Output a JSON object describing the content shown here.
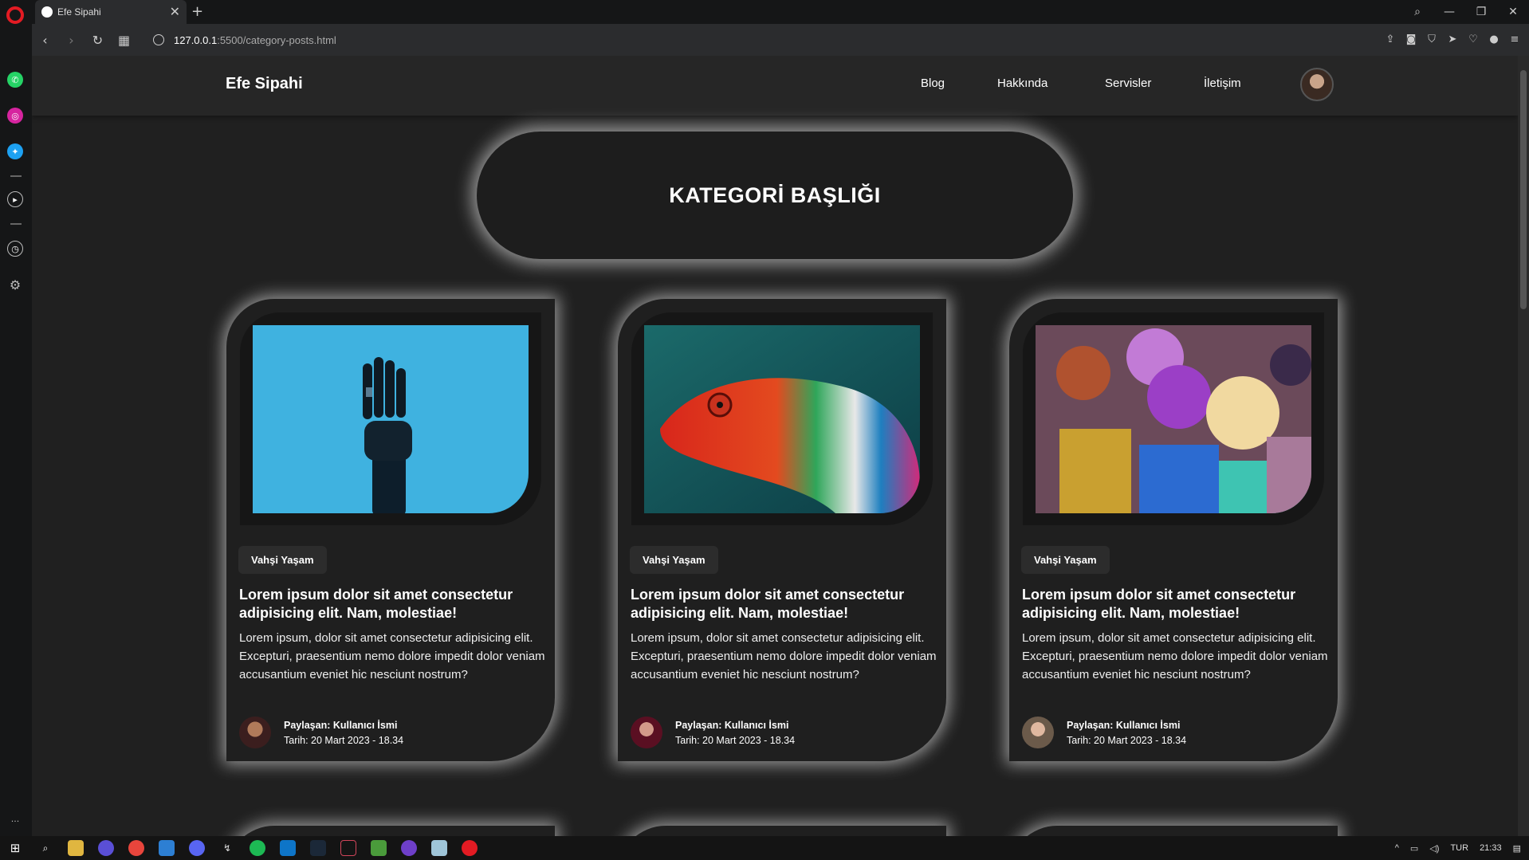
{
  "browser": {
    "tab_title": "Efe Sipahi",
    "tab_close": "✕",
    "new_tab": "+",
    "url_host": "127.0.0.1",
    "url_path": ":5500/category-posts.html"
  },
  "site": {
    "brand": "Efe Sipahi",
    "nav": [
      "Blog",
      "Hakkında",
      "Servisler",
      "İletişim"
    ]
  },
  "hero": {
    "title": "KATEGORİ BAŞLIĞI"
  },
  "cards": [
    {
      "category": "Vahşi Yaşam",
      "title": "Lorem ipsum dolor sit amet consectetur adipisicing elit. Nam, molestiae!",
      "excerpt": "Lorem ipsum, dolor sit amet consectetur adipisicing elit. Excepturi, praesentium nemo dolore impedit dolor veniam accusantium eveniet hic nesciunt nostrum?",
      "author": "Paylaşan: Kullanıcı İsmi",
      "date": "Tarih: 20 Mart 2023 - 18.34"
    },
    {
      "category": "Vahşi Yaşam",
      "title": "Lorem ipsum dolor sit amet consectetur adipisicing elit. Nam, molestiae!",
      "excerpt": "Lorem ipsum, dolor sit amet consectetur adipisicing elit. Excepturi, praesentium nemo dolore impedit dolor veniam accusantium eveniet hic nesciunt nostrum?",
      "author": "Paylaşan: Kullanıcı İsmi",
      "date": "Tarih: 20 Mart 2023 - 18.34"
    },
    {
      "category": "Vahşi Yaşam",
      "title": "Lorem ipsum dolor sit amet consectetur adipisicing elit. Nam, molestiae!",
      "excerpt": "Lorem ipsum, dolor sit amet consectetur adipisicing elit. Excepturi, praesentium nemo dolore impedit dolor veniam accusantium eveniet hic nesciunt nostrum?",
      "author": "Paylaşan: Kullanıcı İsmi",
      "date": "Tarih: 20 Mart 2023 - 18.34"
    }
  ],
  "taskbar": {
    "lang": "TUR",
    "time": "21:33"
  },
  "colors": {
    "page_bg": "#202020",
    "card_bg": "#1f1f1f",
    "glow": "#ffffff",
    "opera_red": "#e31b23"
  }
}
